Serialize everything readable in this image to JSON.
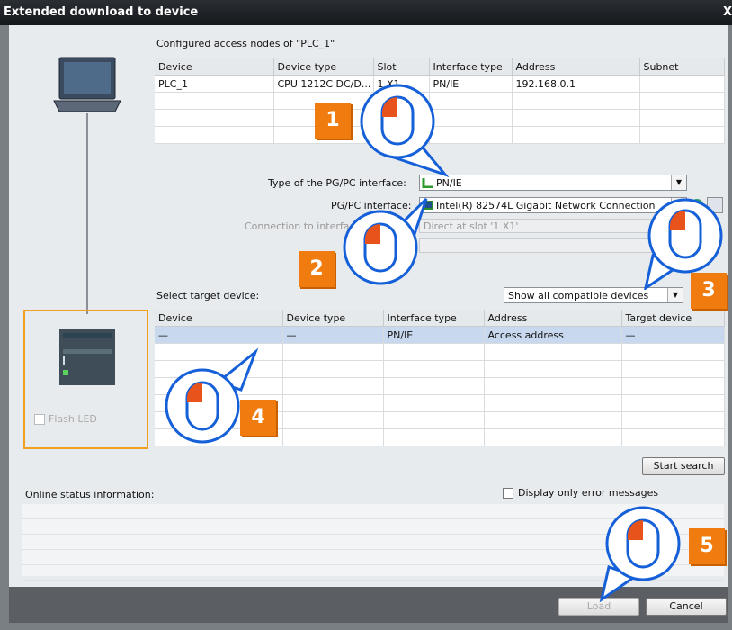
{
  "window": {
    "title": "Extended download to device",
    "close_symbol": "X"
  },
  "access_nodes": {
    "heading": "Configured access nodes of \"PLC_1\"",
    "columns": [
      "Device",
      "Device type",
      "Slot",
      "Interface type",
      "Address",
      "Subnet"
    ],
    "rows": [
      [
        "PLC_1",
        "CPU 1212C DC/D...",
        "1 X1",
        "PN/IE",
        "192.168.0.1",
        ""
      ]
    ]
  },
  "pgpc": {
    "type_label": "Type of the PG/PC interface:",
    "type_value": "PN/IE",
    "interface_label": "PG/PC interface:",
    "interface_value": "Intel(R) 82574L Gigabit Network Connection",
    "connection_label": "Connection to interface/subnet:",
    "connection_value": "Direct at slot '1 X1'"
  },
  "target": {
    "label": "Select target device:",
    "filter_value": "Show all compatible devices",
    "columns": [
      "Device",
      "Device type",
      "Interface type",
      "Address",
      "Target device"
    ],
    "rows": [
      [
        "—",
        "—",
        "PN/IE",
        "Access address",
        "—"
      ]
    ]
  },
  "flash_led_label": "Flash LED",
  "start_search_label": "Start search",
  "online_status": {
    "label": "Online status information:",
    "error_only_label": "Display only error messages"
  },
  "buttons": {
    "load": "Load",
    "cancel": "Cancel"
  },
  "callouts": [
    "1",
    "2",
    "3",
    "4",
    "5"
  ],
  "colors": {
    "accent_orange": "#f07c10",
    "bubble_blue": "#1560d8",
    "selection": "#c8d8ee"
  },
  "icons": [
    "pc-icon",
    "plc-icon",
    "network-icon",
    "mouse-icon"
  ]
}
